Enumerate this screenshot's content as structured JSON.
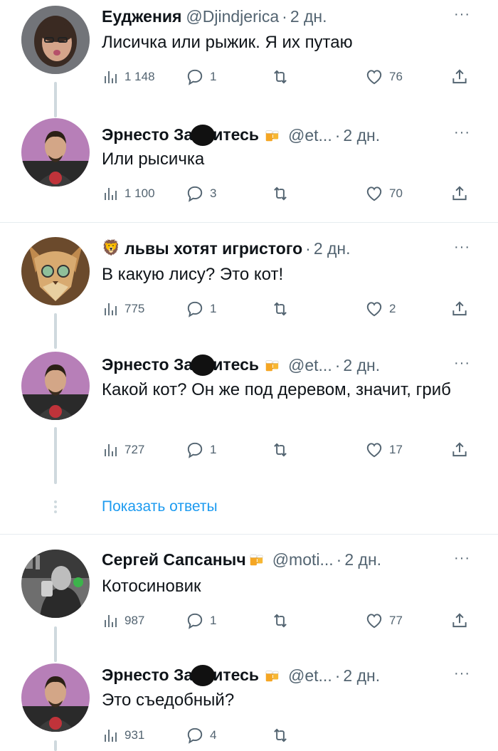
{
  "tweets": [
    {
      "name": "Еуджения",
      "handle": "@Djindjerica",
      "time": "2 дн.",
      "text": "Лисичка или рыжик. Я их путаю",
      "views": "1 148",
      "replies": "1",
      "likes": "76"
    },
    {
      "name_a": "Эрнесто За",
      "name_b": "итесь",
      "handle": "@et...",
      "time": "2 дн.",
      "text": "Или рысичка",
      "views": "1 100",
      "replies": "3",
      "likes": "70"
    },
    {
      "emoji": "🦁",
      "name": "львы хотят игристого",
      "time": "2 дн.",
      "text": "В какую лису? Это кот!",
      "views": "775",
      "replies": "1",
      "likes": "2"
    },
    {
      "name_a": "Эрнесто За",
      "name_b": "итесь",
      "handle": "@et...",
      "time": "2 дн.",
      "text": "Какой кот? Он же под деревом, значит, гриб",
      "views": "727",
      "replies": "1",
      "likes": "17"
    },
    {
      "name": "Сергей Сапсаныч",
      "handle": "@moti...",
      "time": "2 дн.",
      "text": "Котосиновик",
      "views": "987",
      "replies": "1",
      "likes": "77"
    },
    {
      "name_a": "Эрнесто За",
      "name_b": "итесь",
      "handle": "@et...",
      "time": "2 дн.",
      "text": "Это съедобный?",
      "views": "931",
      "replies": "4"
    }
  ],
  "show_replies": "Показать ответы",
  "separator": "·",
  "more_icon": "···",
  "icons": [
    "views-icon",
    "reply-icon",
    "retweet-icon",
    "like-icon",
    "share-icon",
    "beer-emoji-icon"
  ],
  "colors": {
    "link": "#1d9bf0",
    "muted": "#536471",
    "thread_line": "#cfd9de"
  }
}
